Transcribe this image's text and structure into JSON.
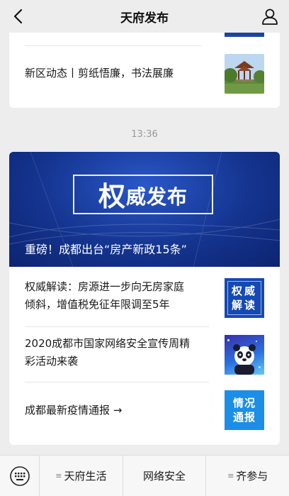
{
  "header": {
    "title": "天府发布"
  },
  "card1": {
    "item_text": "新区动态丨剪纸悟廉，书法展廉"
  },
  "timestamp": "13:36",
  "card2": {
    "banner": {
      "big_char": "权",
      "rest_text": "威发布",
      "caption": "重磅！成都出台“房产新政15条”"
    },
    "items": [
      {
        "line1": "权威解读：房源进一步向无房家庭",
        "line2": "倾斜，增值税免征年限调至5年",
        "thumb_line1": "权威",
        "thumb_line2": "解读"
      },
      {
        "line1": "2020成都市国家网络安全宣传周精",
        "line2": "彩活动来袭"
      },
      {
        "line1": "成都最新疫情通报 →",
        "thumb_line1": "情况",
        "thumb_line2": "通报"
      }
    ]
  },
  "bottom_menu": {
    "tabs": [
      {
        "label": "天府生活",
        "prefix": "≡"
      },
      {
        "label": "网络安全",
        "prefix": ""
      },
      {
        "label": "齐参与",
        "prefix": "≡"
      }
    ]
  },
  "colors": {
    "background": "#ededed",
    "banner_blue": "#14348f",
    "thumb_blue": "#1549b3",
    "thumb_light_blue": "#1c8ee6"
  }
}
